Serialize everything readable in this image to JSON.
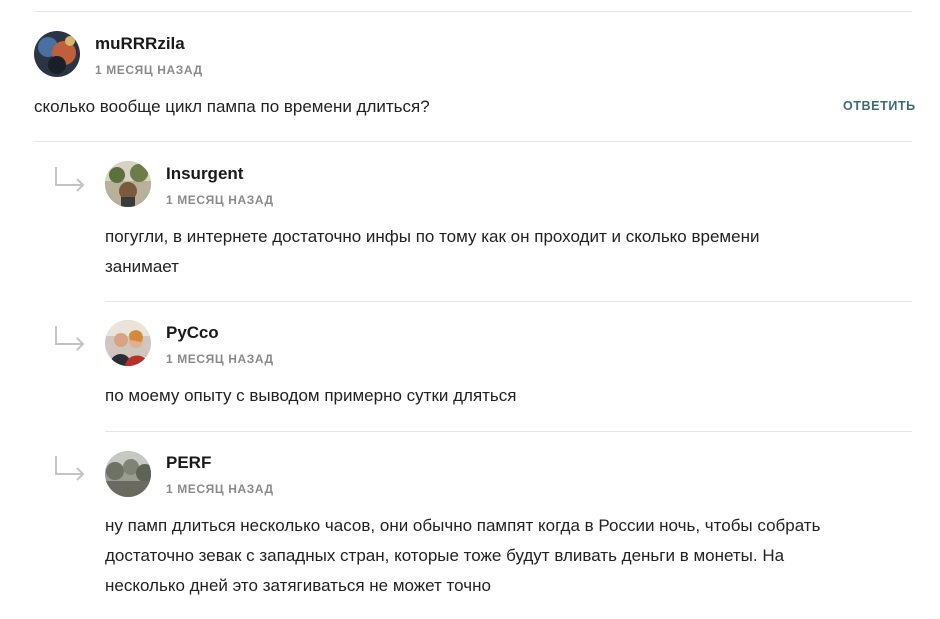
{
  "comments": [
    {
      "author": "muRRRzila",
      "date": "1 МЕСЯЦ НАЗАД",
      "text": "сколько вообще цикл пампа по времени длиться?",
      "reply_label": "ОТВЕТИТЬ",
      "avatar_icon": "user-avatar-dark"
    }
  ],
  "replies": [
    {
      "author": "Insurgent",
      "date": "1 МЕСЯЦ НАЗАД",
      "text_lines": [
        "погугли, в интернете достаточно инфы по тому как он проходит и сколько времени",
        "занимает"
      ],
      "avatar_icon": "user-avatar-outdoor"
    },
    {
      "author": "РуСсо",
      "date": "1 МЕСЯЦ НАЗАД",
      "text_lines": [
        "по моему опыту с выводом примерно сутки дляться"
      ],
      "avatar_icon": "user-avatar-couple"
    },
    {
      "author": "PERF",
      "date": "1 МЕСЯЦ НАЗАД",
      "text_lines": [
        "ну памп длиться несколько часов, они обычно пампят когда в России ночь, чтобы собрать",
        "достаточно зевак с западных стран, которые тоже будут вливать деньги в монеты. На",
        "несколько дней это затягиваться не может точно"
      ],
      "avatar_icon": "user-avatar-landscape"
    }
  ],
  "colors": {
    "reply_link": "#3f6b73",
    "divider": "#e6e6e6",
    "meta": "#8a8a8a"
  }
}
